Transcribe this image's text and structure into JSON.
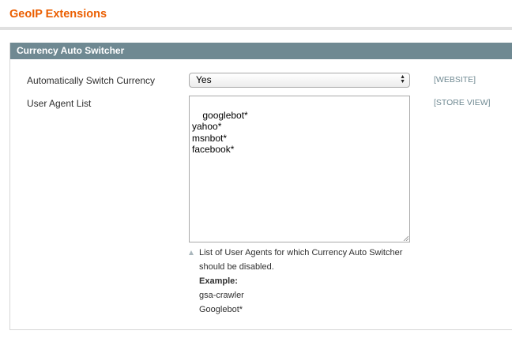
{
  "page": {
    "title": "GeoIP Extensions"
  },
  "section": {
    "title": "Currency Auto Switcher"
  },
  "fields": {
    "auto_switch": {
      "label": "Automatically Switch Currency",
      "value": "Yes",
      "scope": "[WEBSITE]"
    },
    "user_agent_list": {
      "label": "User Agent List",
      "value": "googlebot*\nyahoo*\nmsnbot*\nfacebook*",
      "scope": "[STORE VIEW]",
      "note": {
        "line1": "List of User Agents for which Currency Auto Switcher",
        "line2": "should be disabled.",
        "example_label": "Example:",
        "example1": "gsa-crawler",
        "example2": "Googlebot*"
      }
    }
  },
  "icons": {
    "select_arrows": "updown-arrows-icon",
    "note_marker": "triangle-up-icon",
    "resize": "resize-grip-icon"
  },
  "colors": {
    "title": "#eb5e00",
    "section_header_bg": "#6f8992",
    "scope_text": "#6f8992"
  }
}
